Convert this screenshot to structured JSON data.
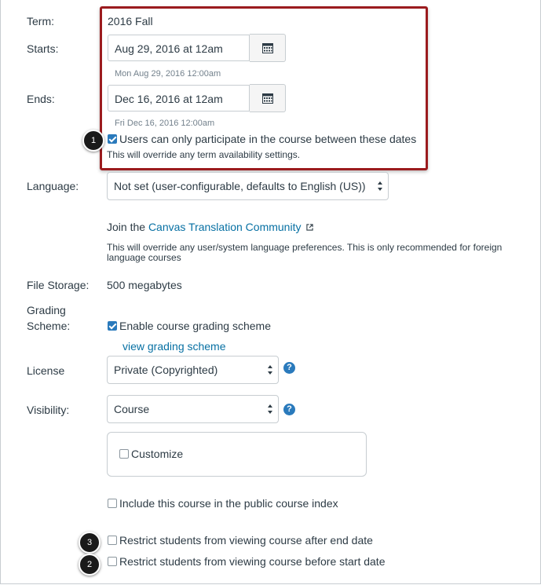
{
  "term": {
    "label": "Term:",
    "value": "2016 Fall"
  },
  "starts": {
    "label": "Starts:",
    "value": "Aug 29, 2016 at 12am",
    "hint": "Mon Aug 29, 2016 12:00am"
  },
  "ends": {
    "label": "Ends:",
    "value": "Dec 16, 2016 at 12am",
    "hint": "Fri Dec 16, 2016 12:00am"
  },
  "restrict_dates": {
    "label": "Users can only participate in the course between these dates",
    "note": "This will override any term availability settings.",
    "checked": true
  },
  "language": {
    "label": "Language:",
    "selected": "Not set (user-configurable, defaults to English (US))",
    "join_prefix": "Join the ",
    "join_link": "Canvas Translation Community",
    "note": "This will override any user/system language preferences. This is only recommended for foreign language courses"
  },
  "file_storage": {
    "label": "File Storage:",
    "value": "500 megabytes"
  },
  "grading": {
    "label_line1": "Grading",
    "label_line2": "Scheme:",
    "checkbox_label": "Enable course grading scheme",
    "checked": true,
    "link": "view grading scheme"
  },
  "license": {
    "label": "License",
    "selected": "Private (Copyrighted)"
  },
  "visibility": {
    "label": "Visibility:",
    "selected": "Course",
    "customize_label": "Customize"
  },
  "public_index": {
    "label": "Include this course in the public course index",
    "checked": false
  },
  "restrict_after": {
    "label": "Restrict students from viewing course after end date",
    "checked": false
  },
  "restrict_before": {
    "label": "Restrict students from viewing course before start date",
    "checked": false
  },
  "badges": {
    "one": "1",
    "two": "2",
    "three": "3"
  },
  "colors": {
    "highlight": "#9b1b1e",
    "link": "#0770a3",
    "checkbox": "#2a7abc"
  }
}
